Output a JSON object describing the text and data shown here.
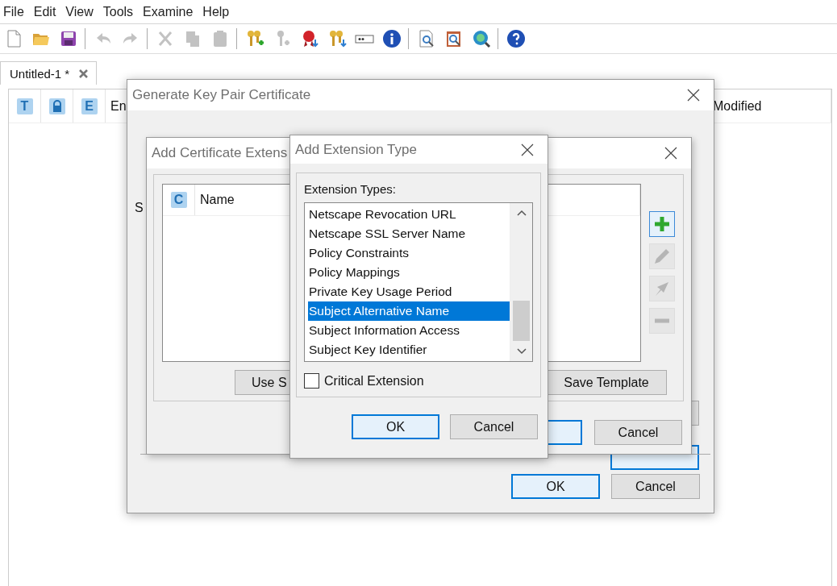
{
  "menu": [
    "File",
    "Edit",
    "View",
    "Tools",
    "Examine",
    "Help"
  ],
  "toolbar": [
    [
      {
        "kind": "new",
        "disabled": false
      },
      {
        "kind": "open",
        "disabled": false
      },
      {
        "kind": "save",
        "disabled": false
      }
    ],
    [
      {
        "kind": "undo",
        "disabled": true
      },
      {
        "kind": "redo",
        "disabled": true
      }
    ],
    [
      {
        "kind": "cut",
        "disabled": true
      },
      {
        "kind": "copy",
        "disabled": true
      },
      {
        "kind": "paste",
        "disabled": true
      }
    ],
    [
      {
        "kind": "keypair-new",
        "disabled": false
      },
      {
        "kind": "key-new",
        "disabled": true
      },
      {
        "kind": "cert-import",
        "disabled": false
      },
      {
        "kind": "keypair-import",
        "disabled": false
      },
      {
        "kind": "password",
        "disabled": false
      },
      {
        "kind": "info",
        "disabled": false
      }
    ],
    [
      {
        "kind": "examine-file",
        "disabled": false
      },
      {
        "kind": "examine-clipboard",
        "disabled": false
      },
      {
        "kind": "examine-url",
        "disabled": false
      }
    ],
    [
      {
        "kind": "help",
        "disabled": false
      }
    ]
  ],
  "tabs": [
    {
      "label": "Untitled-1 *",
      "selected": true
    }
  ],
  "table": {
    "columns": [
      {
        "kind": "badge",
        "text": "T"
      },
      {
        "kind": "lock"
      },
      {
        "kind": "badge",
        "text": "E"
      },
      {
        "kind": "text",
        "text": "En"
      },
      {
        "kind": "text",
        "text": "Modified"
      }
    ]
  },
  "generate_dialog": {
    "title": "Generate Key Pair Certificate",
    "label": "S",
    "hidden_buttons": [
      {
        "default": false
      },
      {
        "default": true
      }
    ],
    "buttons": [
      {
        "label": "OK",
        "default": true
      },
      {
        "label": "Cancel",
        "default": false
      }
    ]
  },
  "extensions_dialog": {
    "title": "Add Certificate Extens",
    "columns": [
      {
        "kind": "badge",
        "text": "C"
      },
      {
        "kind": "text",
        "text": "Name"
      }
    ],
    "actions": [
      {
        "kind": "add",
        "disabled": false
      },
      {
        "kind": "edit",
        "disabled": true
      },
      {
        "kind": "toggle",
        "disabled": true
      },
      {
        "kind": "remove",
        "disabled": true
      }
    ],
    "template_buttons": [
      "Use S",
      "Save Template"
    ],
    "buttons": [
      {
        "default": true
      },
      {
        "label": "Cancel",
        "default": false
      }
    ]
  },
  "extension_type_dialog": {
    "title": "Add Extension Type",
    "list_label": "Extension Types:",
    "items": [
      {
        "label": "Netscape Revocation URL",
        "selected": false
      },
      {
        "label": "Netscape SSL Server Name",
        "selected": false
      },
      {
        "label": "Policy Constraints",
        "selected": false
      },
      {
        "label": "Policy Mappings",
        "selected": false
      },
      {
        "label": "Private Key Usage Period",
        "selected": false
      },
      {
        "label": "Subject Alternative Name",
        "selected": true
      },
      {
        "label": "Subject Information Access",
        "selected": false
      },
      {
        "label": "Subject Key Identifier",
        "selected": false
      }
    ],
    "critical": {
      "label": "Critical Extension",
      "checked": false
    },
    "buttons": [
      {
        "label": "OK",
        "default": true
      },
      {
        "label": "Cancel",
        "default": false
      }
    ]
  }
}
